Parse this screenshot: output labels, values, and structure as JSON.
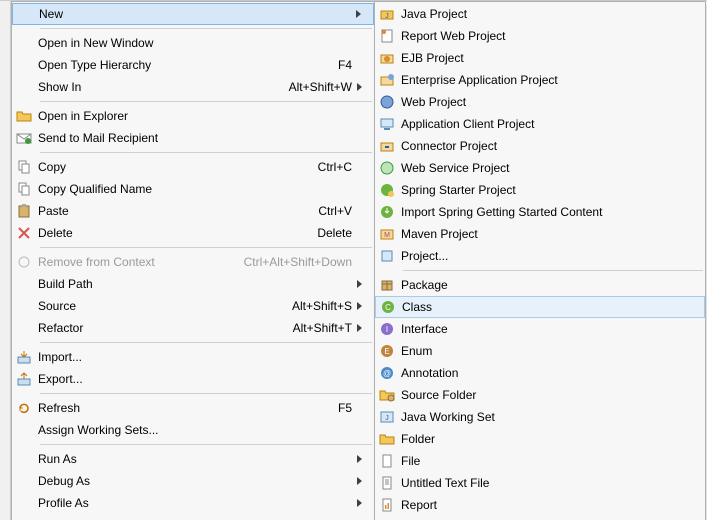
{
  "left_menu": {
    "groups": [
      [
        {
          "id": "new",
          "label": "New",
          "shortcut": "",
          "icon": "blank",
          "submenu": true,
          "disabled": false,
          "highlight": true
        }
      ],
      [
        {
          "id": "open-new-window",
          "label": "Open in New Window",
          "shortcut": "",
          "icon": "blank",
          "submenu": false,
          "disabled": false
        },
        {
          "id": "open-type-hierarchy",
          "label": "Open Type Hierarchy",
          "shortcut": "F4",
          "icon": "blank",
          "submenu": false,
          "disabled": false
        },
        {
          "id": "show-in",
          "label": "Show In",
          "shortcut": "Alt+Shift+W",
          "icon": "blank",
          "submenu": true,
          "disabled": false
        }
      ],
      [
        {
          "id": "open-in-explorer",
          "label": "Open in Explorer",
          "shortcut": "",
          "icon": "folder-open",
          "submenu": false,
          "disabled": false
        },
        {
          "id": "send-to-mail",
          "label": "Send to Mail Recipient",
          "shortcut": "",
          "icon": "mail",
          "submenu": false,
          "disabled": false
        }
      ],
      [
        {
          "id": "copy",
          "label": "Copy",
          "shortcut": "Ctrl+C",
          "icon": "copy",
          "submenu": false,
          "disabled": false
        },
        {
          "id": "copy-qualified",
          "label": "Copy Qualified Name",
          "shortcut": "",
          "icon": "copy-q",
          "submenu": false,
          "disabled": false
        },
        {
          "id": "paste",
          "label": "Paste",
          "shortcut": "Ctrl+V",
          "icon": "paste",
          "submenu": false,
          "disabled": false
        },
        {
          "id": "delete",
          "label": "Delete",
          "shortcut": "Delete",
          "icon": "delete",
          "submenu": false,
          "disabled": false
        }
      ],
      [
        {
          "id": "remove-context",
          "label": "Remove from Context",
          "shortcut": "Ctrl+Alt+Shift+Down",
          "icon": "remove-context",
          "submenu": false,
          "disabled": true
        },
        {
          "id": "build-path",
          "label": "Build Path",
          "shortcut": "",
          "icon": "blank",
          "submenu": true,
          "disabled": false
        },
        {
          "id": "source",
          "label": "Source",
          "shortcut": "Alt+Shift+S",
          "icon": "blank",
          "submenu": true,
          "disabled": false
        },
        {
          "id": "refactor",
          "label": "Refactor",
          "shortcut": "Alt+Shift+T",
          "icon": "blank",
          "submenu": true,
          "disabled": false
        }
      ],
      [
        {
          "id": "import",
          "label": "Import...",
          "shortcut": "",
          "icon": "import",
          "submenu": false,
          "disabled": false
        },
        {
          "id": "export",
          "label": "Export...",
          "shortcut": "",
          "icon": "export",
          "submenu": false,
          "disabled": false
        }
      ],
      [
        {
          "id": "refresh",
          "label": "Refresh",
          "shortcut": "F5",
          "icon": "refresh",
          "submenu": false,
          "disabled": false
        },
        {
          "id": "assign-ws",
          "label": "Assign Working Sets...",
          "shortcut": "",
          "icon": "blank",
          "submenu": false,
          "disabled": false
        }
      ],
      [
        {
          "id": "run-as",
          "label": "Run As",
          "shortcut": "",
          "icon": "blank",
          "submenu": true,
          "disabled": false
        },
        {
          "id": "debug-as",
          "label": "Debug As",
          "shortcut": "",
          "icon": "blank",
          "submenu": true,
          "disabled": false
        },
        {
          "id": "profile-as",
          "label": "Profile As",
          "shortcut": "",
          "icon": "blank",
          "submenu": true,
          "disabled": false
        }
      ]
    ]
  },
  "right_menu": {
    "groups": [
      [
        {
          "id": "java-project",
          "label": "Java Project",
          "icon": "java-project"
        },
        {
          "id": "report-web-project",
          "label": "Report Web Project",
          "icon": "report"
        },
        {
          "id": "ejb-project",
          "label": "EJB Project",
          "icon": "ejb"
        },
        {
          "id": "enterprise-app-project",
          "label": "Enterprise Application Project",
          "icon": "ear"
        },
        {
          "id": "web-project",
          "label": "Web Project",
          "icon": "web"
        },
        {
          "id": "app-client-project",
          "label": "Application Client Project",
          "icon": "app-client"
        },
        {
          "id": "connector-project",
          "label": "Connector Project",
          "icon": "connector"
        },
        {
          "id": "web-service-project",
          "label": "Web Service Project",
          "icon": "web-service"
        },
        {
          "id": "spring-starter",
          "label": "Spring Starter Project",
          "icon": "spring-starter"
        },
        {
          "id": "spring-import",
          "label": "Import Spring Getting Started Content",
          "icon": "spring-import"
        },
        {
          "id": "maven-project",
          "label": "Maven Project",
          "icon": "maven"
        },
        {
          "id": "project",
          "label": "Project...",
          "icon": "project"
        }
      ],
      [
        {
          "id": "package",
          "label": "Package",
          "icon": "package"
        },
        {
          "id": "class",
          "label": "Class",
          "icon": "class",
          "highlight": true
        },
        {
          "id": "interface",
          "label": "Interface",
          "icon": "interface"
        },
        {
          "id": "enum",
          "label": "Enum",
          "icon": "enum"
        },
        {
          "id": "annotation",
          "label": "Annotation",
          "icon": "annotation"
        },
        {
          "id": "source-folder",
          "label": "Source Folder",
          "icon": "source-folder"
        },
        {
          "id": "java-ws",
          "label": "Java Working Set",
          "icon": "java-ws"
        },
        {
          "id": "folder",
          "label": "Folder",
          "icon": "folder"
        },
        {
          "id": "file",
          "label": "File",
          "icon": "file"
        },
        {
          "id": "untitled-text",
          "label": "Untitled Text File",
          "icon": "text-file"
        },
        {
          "id": "report",
          "label": "Report",
          "icon": "report2"
        }
      ]
    ]
  }
}
